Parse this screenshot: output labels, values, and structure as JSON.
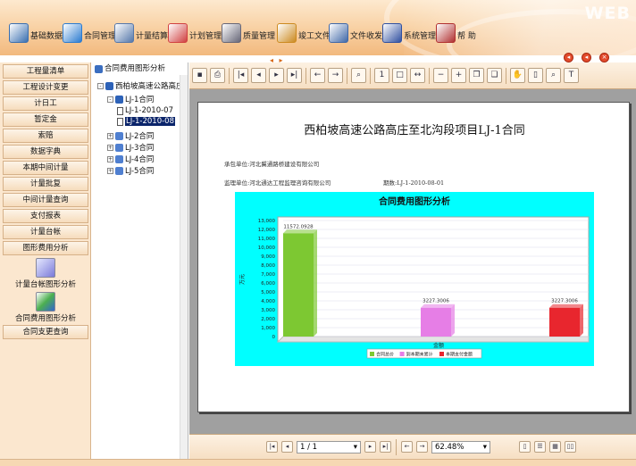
{
  "header": {
    "brand": "WEB",
    "toolbar": [
      {
        "label": "基础数据",
        "icon": "database-icon",
        "color": "#3a6fb0"
      },
      {
        "label": "合同管理",
        "icon": "contract-icon",
        "color": "#2b7bd0"
      },
      {
        "label": "计量结算",
        "icon": "calculator-icon",
        "color": "#5577aa"
      },
      {
        "label": "计划管理",
        "icon": "plan-chart-icon",
        "color": "#d04040"
      },
      {
        "label": "质量管理",
        "icon": "gear-icon",
        "color": "#666677"
      },
      {
        "label": "竣工文件",
        "icon": "folder-icon",
        "color": "#cc8a20"
      },
      {
        "label": "文件收发",
        "icon": "mail-icon",
        "color": "#4068a8"
      },
      {
        "label": "系统管理",
        "icon": "system-icon",
        "color": "#3050a0"
      },
      {
        "label": "帮 助",
        "icon": "help-icon",
        "color": "#b03030"
      }
    ],
    "window_controls": [
      "minimize-icon",
      "restore-icon",
      "close-icon"
    ]
  },
  "sidebar": {
    "items": [
      "工程量清单",
      "工程设计变更",
      "计日工",
      "暂定金",
      "索赔",
      "数据字典",
      "本期中间计量",
      "计量批复",
      "中间计量查询",
      "支付报表",
      "计量台帐",
      "图形费用分析"
    ],
    "icon_items": [
      {
        "label": "计量台帐图形分析",
        "icon": "ledger-chart-icon"
      },
      {
        "label": "合同费用图形分析",
        "icon": "cost-chart-icon"
      }
    ],
    "last_item": "合同支更查询"
  },
  "tree": {
    "header": "合同费用图形分析",
    "root": "西柏坡高速公路高庄",
    "nodes": [
      {
        "label": "LJ-1合同",
        "expander": "-"
      },
      {
        "label": "LJ-1-2010-07",
        "expander": ""
      },
      {
        "label": "LJ-1-2010-08",
        "expander": "",
        "selected": true
      },
      {
        "label": "LJ-2合同",
        "expander": "+"
      },
      {
        "label": "LJ-3合同",
        "expander": "+"
      },
      {
        "label": "LJ-4合同",
        "expander": "+"
      },
      {
        "label": "LJ-5合同",
        "expander": "+"
      }
    ]
  },
  "report": {
    "title": "西柏坡高速公路高庄至北沟段项目LJ-1合同",
    "contractor": "承包单位:河北冀通路桥建设有限公司",
    "supervisor": "监理单位:河北通达工程监理咨询有限公司",
    "period": "期数:LJ-1-2010-08-01"
  },
  "viewer": {
    "page_indicator": "1 / 1",
    "zoom": "62.48%"
  },
  "chart_data": {
    "type": "bar",
    "title": "合同费用图形分析",
    "ylabel": "万元",
    "xlabel": "金额",
    "ylim": [
      0,
      13000
    ],
    "yticks": [
      0,
      1000,
      2000,
      3000,
      4000,
      5000,
      6000,
      7000,
      8000,
      9000,
      10000,
      11000,
      12000,
      13000
    ],
    "ytick_labels": [
      "0",
      "1,000",
      "2,000",
      "3,000",
      "4,000",
      "5,000",
      "6,000",
      "7,000",
      "8,000",
      "9,000",
      "10,000",
      "11,000",
      "12,000",
      "13,000"
    ],
    "series": [
      {
        "name": "合同总价",
        "value": 11572.0928,
        "label": "11572.0928",
        "color": "#7dc832"
      },
      {
        "name": "到本期末累计",
        "value": 3227.3006,
        "label": "3227.3006",
        "color": "#e67ee6"
      },
      {
        "name": "本期支付金额",
        "value": 3227.3006,
        "label": "3227.3006",
        "color": "#e8262e"
      }
    ],
    "background": "#00ffff",
    "grid": true,
    "legend": "bottom"
  }
}
